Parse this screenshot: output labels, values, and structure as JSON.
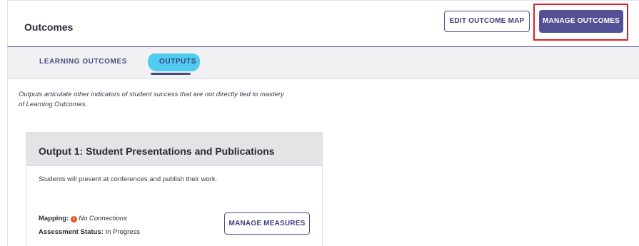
{
  "header": {
    "title": "Outcomes",
    "edit_button": "EDIT OUTCOME MAP",
    "manage_button": "MANAGE OUTCOMES"
  },
  "tabs": [
    {
      "label": "LEARNING OUTCOMES",
      "active": false
    },
    {
      "label": "OUTPUTS",
      "active": true
    }
  ],
  "description": "Outputs articulate other indicators of student success that are not directly tied to mastery of Learning Outcomes.",
  "card": {
    "title": "Output 1: Student Presentations and Publications",
    "body": "Students will present at conferences and publish their work.",
    "mapping_label": "Mapping:",
    "mapping_value": "No Connections",
    "warning_glyph": "!",
    "assessment_label": "Assessment Status:",
    "assessment_value": "In Progress",
    "measures_button": "MANAGE MEASURES"
  },
  "colors": {
    "accent": "#545096",
    "highlight_frame": "#dd1f26",
    "marker": "#46c9ee",
    "warning": "#e05a1c"
  },
  "icons": {
    "mapping_status": "warning-dot-icon"
  }
}
